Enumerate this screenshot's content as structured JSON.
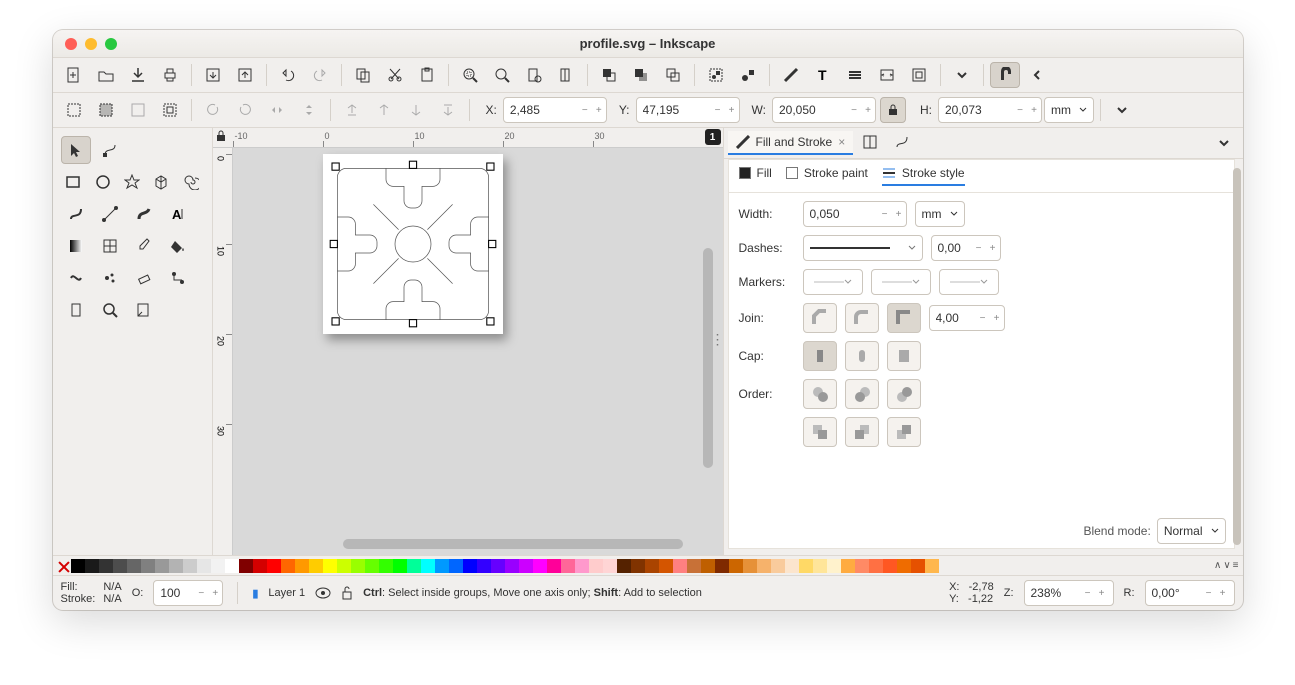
{
  "window": {
    "title": "profile.svg – Inkscape"
  },
  "options": {
    "x_label": "X:",
    "x": "2,485",
    "y_label": "Y:",
    "y": "47,195",
    "w_label": "W:",
    "w": "20,050",
    "h_label": "H:",
    "h": "20,073",
    "unit": "mm"
  },
  "ruler_h": [
    "-10",
    "0",
    "10",
    "20",
    "30"
  ],
  "ruler_v": [
    "0",
    "10",
    "20",
    "30"
  ],
  "ruler_end": "1",
  "dock": {
    "tab_fill_stroke": "Fill and Stroke",
    "fs": {
      "fill": "Fill",
      "stroke_paint": "Stroke paint",
      "stroke_style": "Stroke style"
    },
    "width_label": "Width:",
    "width_value": "0,050",
    "width_unit": "mm",
    "dashes_label": "Dashes:",
    "dash_offset": "0,00",
    "markers_label": "Markers:",
    "join_label": "Join:",
    "miter_limit": "4,00",
    "cap_label": "Cap:",
    "order_label": "Order:",
    "blend_label": "Blend mode:",
    "blend_value": "Normal"
  },
  "status": {
    "fill_label": "Fill:",
    "fill_value": "N/A",
    "stroke_label": "Stroke:",
    "stroke_value": "N/A",
    "opacity_label": "O:",
    "opacity_value": "100",
    "layer": "Layer 1",
    "hint_parts": {
      "ctrl": "Ctrl",
      "ctrl_text": ": Select inside groups, Move one axis only; ",
      "shift": "Shift",
      "shift_text": ": Add to selection"
    },
    "x_label": "X:",
    "x": "-2,78",
    "y_label": "Y:",
    "y": "-1,22",
    "z_label": "Z:",
    "z": "238%",
    "r_label": "R:",
    "r": "0,00°"
  },
  "palette_grays": [
    "#000000",
    "#1a1a1a",
    "#333333",
    "#4d4d4d",
    "#666666",
    "#808080",
    "#999999",
    "#b3b3b3",
    "#cccccc",
    "#e6e6e6",
    "#f2f2f2",
    "#ffffff"
  ],
  "palette_colors": [
    "#800000",
    "#d40000",
    "#ff0000",
    "#ff6600",
    "#ff9900",
    "#ffcc00",
    "#ffff00",
    "#ccff00",
    "#99ff00",
    "#66ff00",
    "#33ff00",
    "#00ff00",
    "#00ff99",
    "#00ffff",
    "#0099ff",
    "#0066ff",
    "#0000ff",
    "#3300ff",
    "#6600ff",
    "#9900ff",
    "#cc00ff",
    "#ff00ff",
    "#ff0099",
    "#ff6699",
    "#ff99cc",
    "#ffcccc",
    "#ffd5d5",
    "#552200",
    "#803300",
    "#aa4400",
    "#d45500",
    "#ff8080",
    "#c87137",
    "#bf5f00",
    "#7f2a00",
    "#cc6600",
    "#e69138",
    "#f6b26b",
    "#f9cb9c",
    "#fce5cd",
    "#ffd966",
    "#ffe599",
    "#fff2cc",
    "#ffab40",
    "#ff8a65",
    "#ff7043",
    "#ff5722",
    "#ef6c00",
    "#e65100",
    "#ffb74d"
  ]
}
